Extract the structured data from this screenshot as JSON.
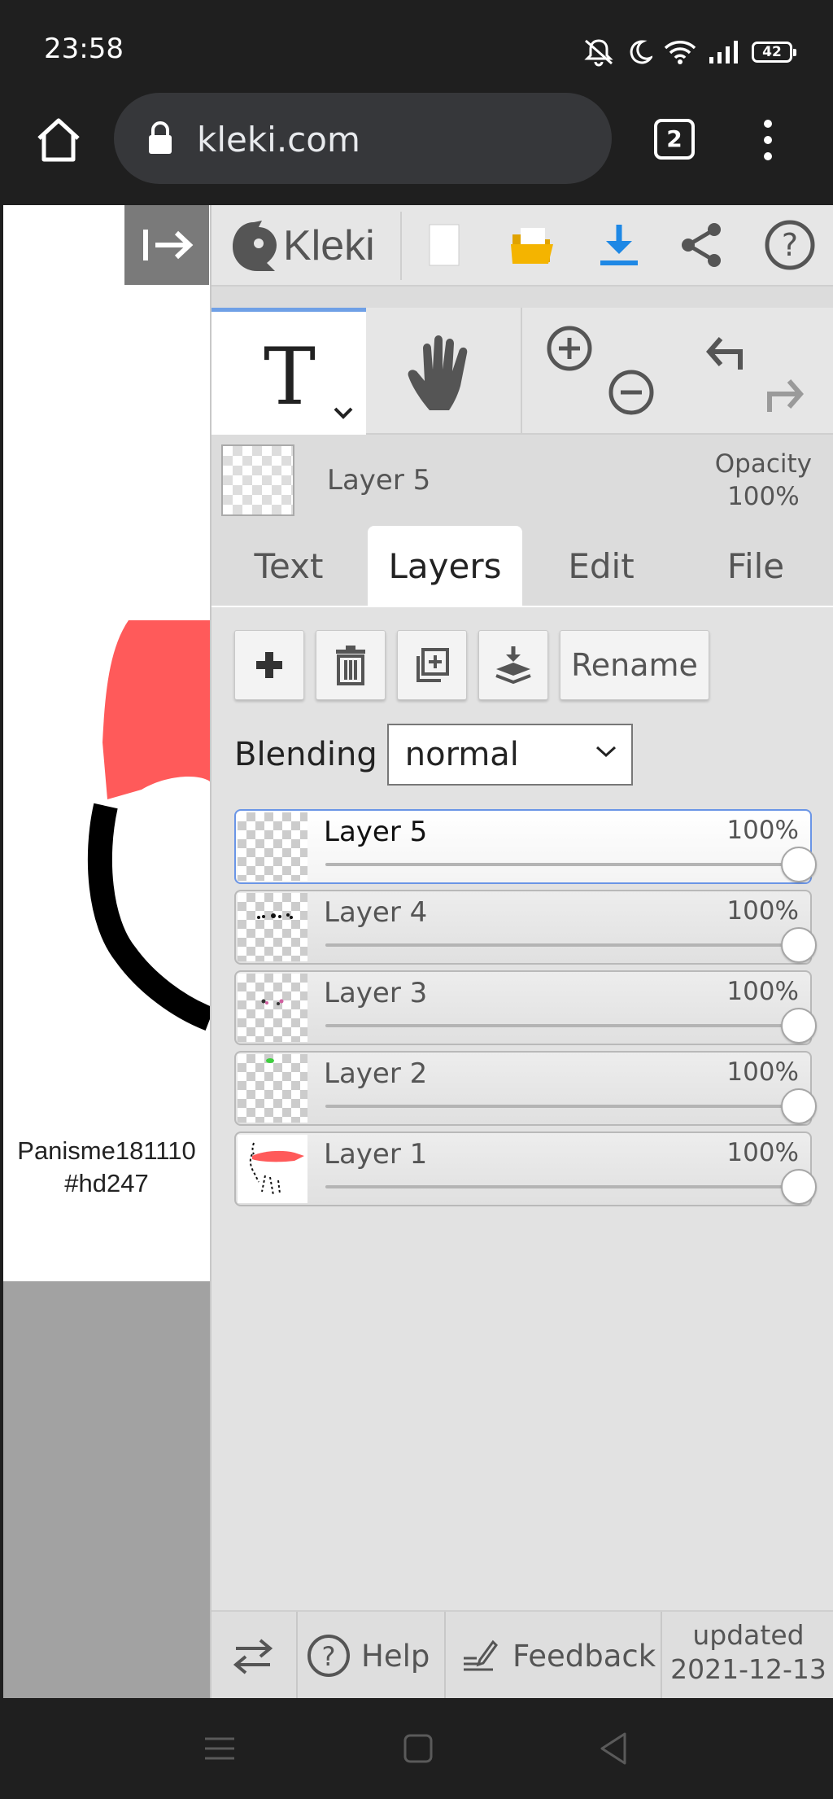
{
  "status_bar": {
    "time": "23:58",
    "battery": "42"
  },
  "browser": {
    "url": "kleki.com",
    "tab_count": "2"
  },
  "canvas": {
    "watermark_line1": "Panisme181110",
    "watermark_line2": "#hd247"
  },
  "app": {
    "logo": "Kleki"
  },
  "current_layer": {
    "name": "Layer 5",
    "opacity_label": "Opacity",
    "opacity_value": "100%"
  },
  "tabs": [
    {
      "label": "Text"
    },
    {
      "label": "Layers"
    },
    {
      "label": "Edit"
    },
    {
      "label": "File"
    }
  ],
  "layers_panel": {
    "rename_label": "Rename",
    "blending_label": "Blending",
    "blending_value": "normal",
    "layers": [
      {
        "name": "Layer 5",
        "opacity": "100%",
        "opacity_fraction": 1.0
      },
      {
        "name": "Layer 4",
        "opacity": "100%",
        "opacity_fraction": 1.0
      },
      {
        "name": "Layer 3",
        "opacity": "100%",
        "opacity_fraction": 1.0
      },
      {
        "name": "Layer 2",
        "opacity": "100%",
        "opacity_fraction": 1.0
      },
      {
        "name": "Layer 1",
        "opacity": "100%",
        "opacity_fraction": 1.0
      }
    ]
  },
  "bottom_bar": {
    "help_label": "Help",
    "feedback_label": "Feedback",
    "updated_line1": "updated",
    "updated_line2": "2021-12-13"
  },
  "colors": {
    "accent": "#6fa0e6",
    "download": "#1e88e5",
    "folder": "#f4b400",
    "stroke_red": "#ff5a5a"
  }
}
